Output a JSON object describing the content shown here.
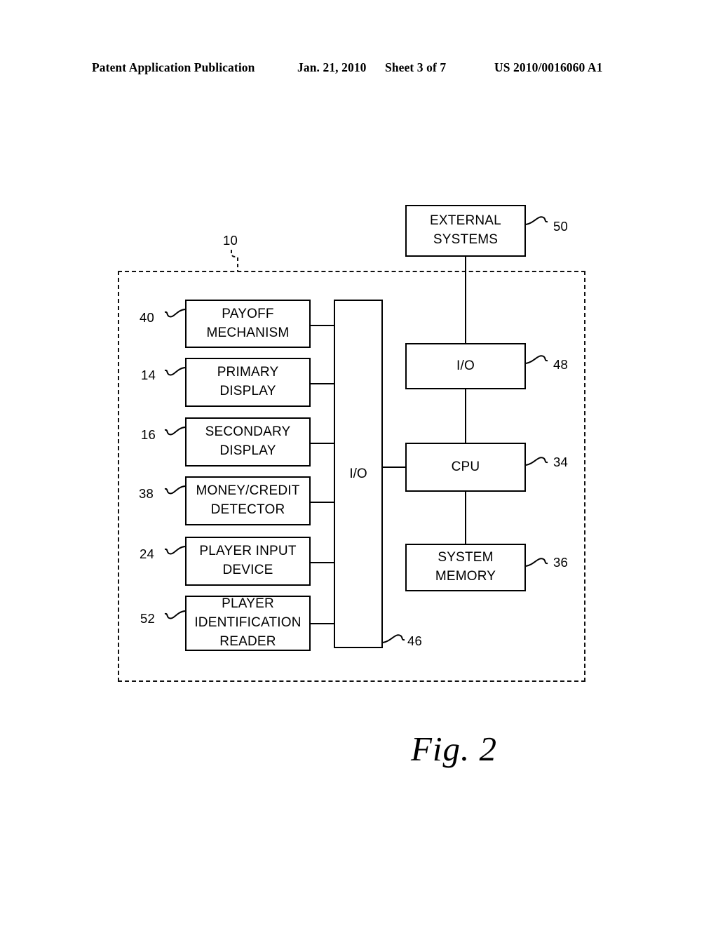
{
  "header": {
    "publication": "Patent Application Publication",
    "date": "Jan. 21, 2010",
    "sheet": "Sheet 3 of 7",
    "doc_number": "US 2010/0016060 A1"
  },
  "figure": {
    "caption": "Fig. 2",
    "machine_ref": "10",
    "blocks": {
      "external_systems": {
        "line1": "EXTERNAL",
        "line2": "SYSTEMS",
        "ref": "50"
      },
      "io_upper": {
        "line1": "I/O",
        "ref": "48"
      },
      "cpu": {
        "line1": "CPU",
        "ref": "34"
      },
      "system_memory": {
        "line1": "SYSTEM",
        "line2": "MEMORY",
        "ref": "36"
      },
      "io_bus": {
        "line1": "I/O",
        "ref": "46"
      },
      "payoff_mechanism": {
        "line1": "PAYOFF",
        "line2": "MECHANISM",
        "ref": "40"
      },
      "primary_display": {
        "line1": "PRIMARY",
        "line2": "DISPLAY",
        "ref": "14"
      },
      "secondary_display": {
        "line1": "SECONDARY",
        "line2": "DISPLAY",
        "ref": "16"
      },
      "money_credit_detector": {
        "line1": "MONEY/CREDIT",
        "line2": "DETECTOR",
        "ref": "38"
      },
      "player_input_device": {
        "line1": "PLAYER INPUT",
        "line2": "DEVICE",
        "ref": "24"
      },
      "player_identification_reader": {
        "line1": "PLAYER",
        "line2": "IDENTIFICATION",
        "line3": "READER",
        "ref": "52"
      }
    }
  },
  "colors": {
    "ink": "#000000",
    "paper": "#ffffff"
  }
}
